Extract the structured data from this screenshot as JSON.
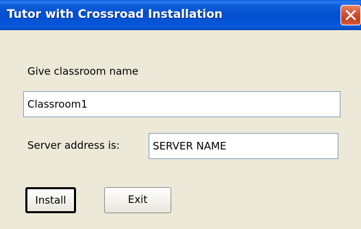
{
  "window": {
    "title": "Tutor with Crossroad Installation",
    "close_icon": "close-icon"
  },
  "form": {
    "classroom_label": "Give classroom name",
    "classroom_value": "Classroom1",
    "server_label": "Server address is:",
    "server_value": "SERVER NAME"
  },
  "buttons": {
    "install_label": "Install",
    "exit_label": "Exit"
  },
  "colors": {
    "titlebar": "#0554d6",
    "dialog_background": "#ece9d8",
    "close_button": "#d9573a"
  }
}
